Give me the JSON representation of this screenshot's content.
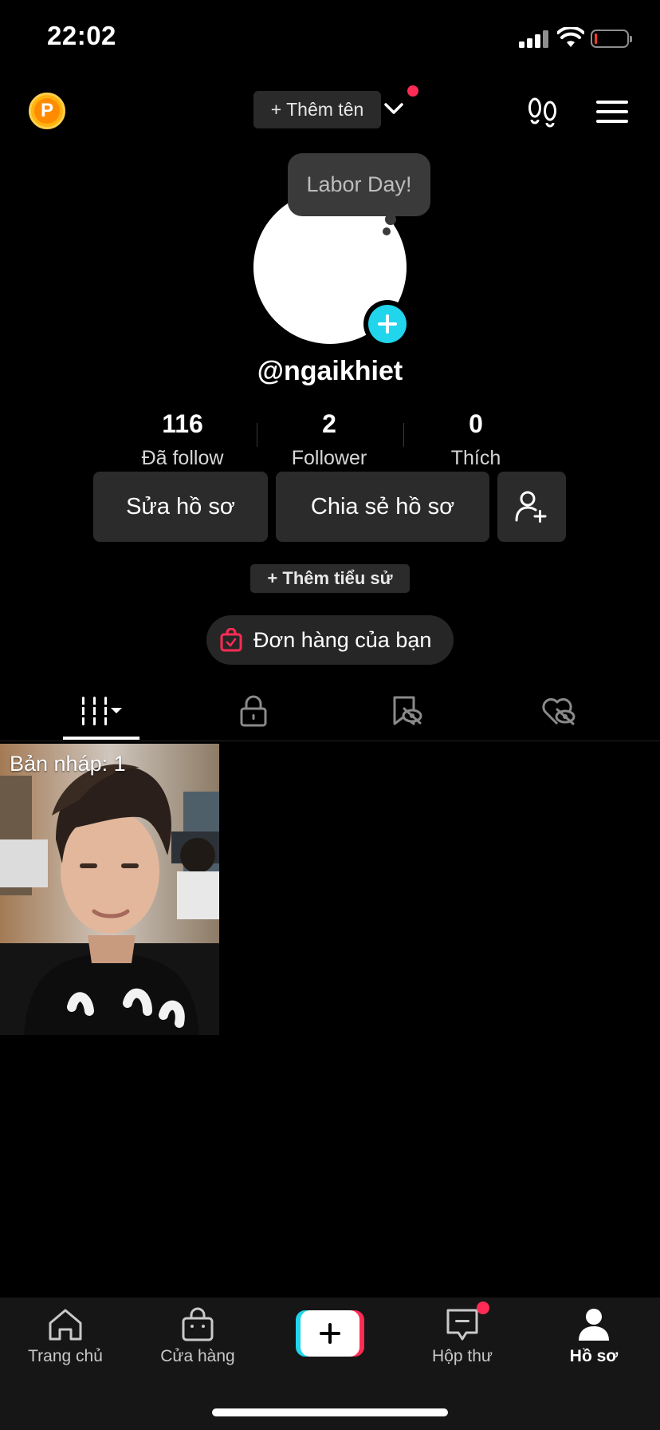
{
  "status_bar": {
    "time": "22:02",
    "icons": [
      "signal-icon",
      "wifi-icon",
      "battery-icon"
    ],
    "battery_level": 0.05,
    "battery_color": "#ff3b30"
  },
  "header": {
    "coin_letter": "P",
    "add_name_label": "+ Thêm tên",
    "has_notification": true
  },
  "tooltip": {
    "text": "Labor Day!"
  },
  "profile": {
    "username": "@ngaikhiet",
    "stats": [
      {
        "value": "116",
        "label": "Đã follow"
      },
      {
        "value": "2",
        "label": "Follower"
      },
      {
        "value": "0",
        "label": "Thích"
      }
    ]
  },
  "actions": {
    "edit_profile": "Sửa hồ sơ",
    "share_profile": "Chia sẻ hồ sơ",
    "add_bio": "+ Thêm tiểu sử",
    "orders": "Đơn hàng của bạn"
  },
  "tabs": [
    {
      "icon": "videos-grid-icon",
      "active": true
    },
    {
      "icon": "lock-icon",
      "active": false
    },
    {
      "icon": "bookmark-hidden-icon",
      "active": false
    },
    {
      "icon": "heart-hidden-icon",
      "active": false
    }
  ],
  "content": {
    "draft_label": "Bản nháp: 1"
  },
  "bottom_nav": [
    {
      "label": "Trang chủ",
      "icon": "home-icon",
      "active": false
    },
    {
      "label": "Cửa hàng",
      "icon": "shop-icon",
      "active": false
    },
    {
      "label": "",
      "icon": "create-plus-icon",
      "active": false
    },
    {
      "label": "Hộp thư",
      "icon": "inbox-icon",
      "active": false,
      "badge": true
    },
    {
      "label": "Hồ sơ",
      "icon": "profile-icon",
      "active": true
    }
  ],
  "colors": {
    "accent_red": "#fe2c55",
    "accent_cyan": "#20d5ec",
    "coin": "#ffb30f",
    "background": "#000000"
  }
}
